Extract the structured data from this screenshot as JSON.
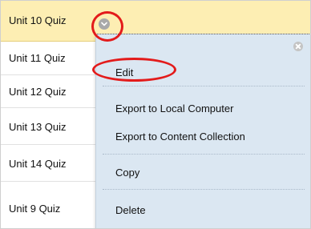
{
  "quizzes": [
    {
      "label": "Unit 10 Quiz",
      "selected": true
    },
    {
      "label": "Unit 11 Quiz"
    },
    {
      "label": "Unit 12 Quiz"
    },
    {
      "label": "Unit 13 Quiz"
    },
    {
      "label": "Unit 14 Quiz"
    },
    {
      "label": "Unit 9 Quiz"
    }
  ],
  "context_menu": {
    "items": [
      {
        "label": "Edit",
        "highlighted": true
      },
      {
        "label": "Export to Local Computer"
      },
      {
        "label": "Export to Content Collection"
      },
      {
        "label": "Copy"
      },
      {
        "label": "Delete"
      }
    ],
    "close_icon": "close-circle-icon"
  },
  "open_menu_icon": "chevron-down-icon",
  "colors": {
    "selected_row": "#fdeeb3",
    "menu_background": "#dbe7f2",
    "annotation_red": "#e31b1b"
  }
}
